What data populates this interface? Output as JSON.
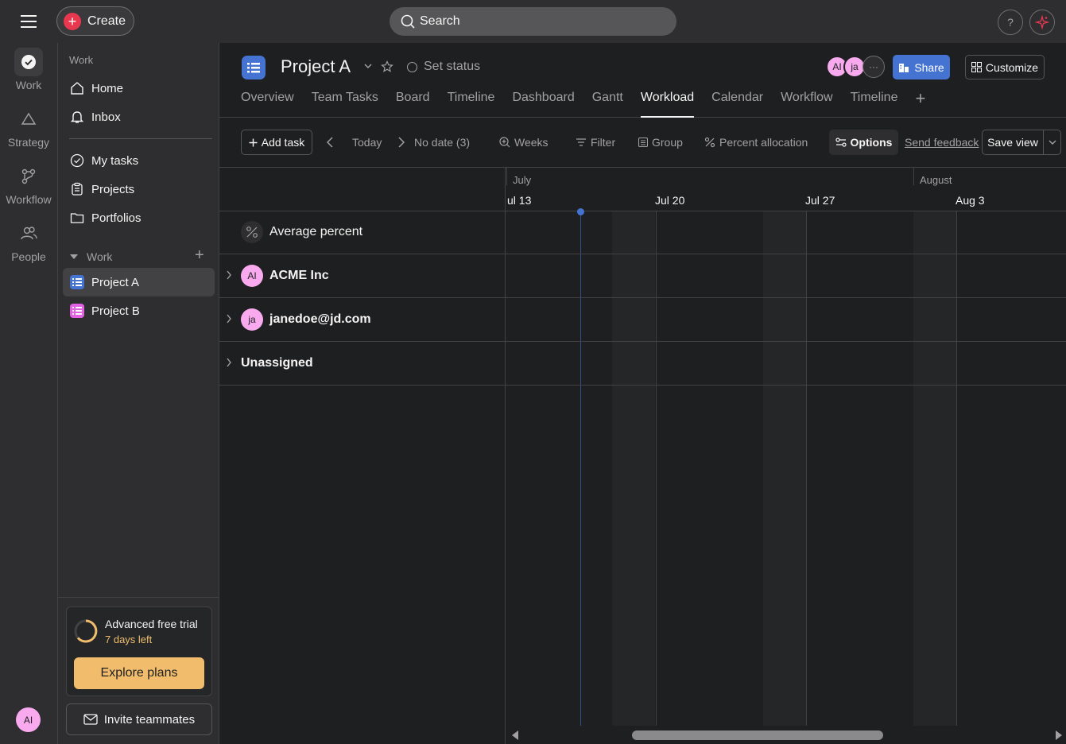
{
  "topbar": {
    "create_label": "Create",
    "search_label": "Search",
    "help_label": "?"
  },
  "rail": {
    "items": [
      {
        "label": "Work",
        "icon": "check-circle-icon"
      },
      {
        "label": "Strategy",
        "icon": "triangle-icon"
      },
      {
        "label": "Workflow",
        "icon": "workflow-icon"
      },
      {
        "label": "People",
        "icon": "people-icon"
      }
    ],
    "avatar": "AI"
  },
  "sidebar": {
    "heading": "Work",
    "nav": [
      {
        "label": "Home",
        "icon": "home-icon"
      },
      {
        "label": "Inbox",
        "icon": "bell-icon"
      }
    ],
    "nav2": [
      {
        "label": "My tasks",
        "icon": "check-circle-icon"
      },
      {
        "label": "Projects",
        "icon": "clipboard-icon"
      },
      {
        "label": "Portfolios",
        "icon": "folder-icon"
      }
    ],
    "section": "Work",
    "projects": [
      {
        "label": "Project A",
        "color": "#4573d2"
      },
      {
        "label": "Project B",
        "color": "#e362e3"
      }
    ],
    "trial": {
      "title": "Advanced free trial",
      "days": "7 days left",
      "explore": "Explore plans"
    },
    "invite": "Invite teammates"
  },
  "header": {
    "title": "Project A",
    "set_status": "Set status",
    "members": [
      "AI",
      "ja"
    ],
    "share": "Share",
    "customize": "Customize",
    "tabs": [
      "Overview",
      "Team Tasks",
      "Board",
      "Timeline",
      "Dashboard",
      "Gantt",
      "Workload",
      "Calendar",
      "Workflow",
      "Timeline"
    ],
    "active_tab": "Workload"
  },
  "toolbar": {
    "add_task": "Add task",
    "today": "Today",
    "no_date": "No date (3)",
    "weeks": "Weeks",
    "filter": "Filter",
    "group": "Group",
    "percent_allocation": "Percent allocation",
    "options": "Options",
    "send_feedback": "Send feedback",
    "save_view": "Save view"
  },
  "timeline": {
    "months": [
      "July",
      "August"
    ],
    "days": [
      "ul 13",
      "Jul 20",
      "Jul 27",
      "Aug 3"
    ],
    "rows": [
      {
        "label": "Average percent",
        "type": "average"
      },
      {
        "label": "ACME Inc",
        "avatar": "AI",
        "type": "person"
      },
      {
        "label": "janedoe@jd.com",
        "avatar": "ja",
        "type": "person"
      },
      {
        "label": "Unassigned",
        "type": "unassigned"
      }
    ]
  },
  "colors": {
    "accent": "#4573d2",
    "avatar": "#f9aaef",
    "trial": "#f1bd6c",
    "create": "#e8384f"
  }
}
